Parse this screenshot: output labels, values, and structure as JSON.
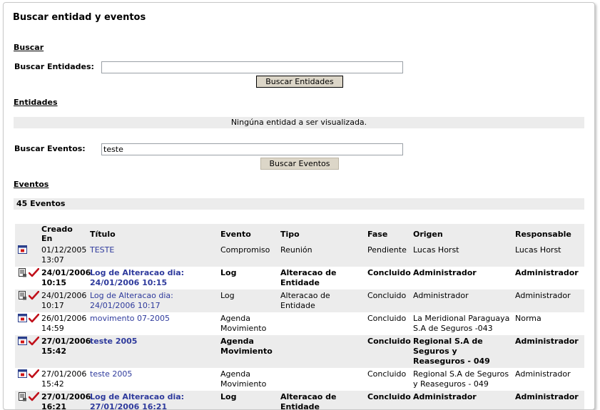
{
  "page_title": "Buscar entidad y eventos",
  "search_section": {
    "title": "Buscar",
    "entities_label": "Buscar Entidades:",
    "entities_value": "",
    "entities_button": "Buscar Entidades"
  },
  "entities_section": {
    "title": "Entidades",
    "empty_message": "Ningúna entidad a ser visualizada."
  },
  "events_search": {
    "label": "Buscar Eventos:",
    "value": "teste",
    "button": "Buscar Eventos"
  },
  "events_section": {
    "title": "Eventos",
    "count_label": "45 Eventos"
  },
  "table": {
    "headers": {
      "created": "Creado En",
      "title": "Título",
      "event": "Evento",
      "type": "Tipo",
      "phase": "Fase",
      "origin": "Origen",
      "responsible": "Responsable"
    },
    "rows": [
      {
        "icons": [
          "calendar-icon"
        ],
        "created": "01/12/2005 13:07",
        "title": "TESTE",
        "event": "Compromiso",
        "type": "Reunión",
        "phase": "Pendiente",
        "origin": "Lucas Horst",
        "responsible": "Lucas Horst",
        "bold": false
      },
      {
        "icons": [
          "log-icon",
          "check-icon"
        ],
        "created": "24/01/2006 10:15",
        "title": "Log de Alteracao dia: 24/01/2006 10:15",
        "event": "Log",
        "type": "Alteracao de Entidade",
        "phase": "Concluido",
        "origin": "Administrador",
        "responsible": "Administrador",
        "bold": true
      },
      {
        "icons": [
          "log-icon",
          "check-icon"
        ],
        "created": "24/01/2006 10:17",
        "title": "Log de Alteracao dia: 24/01/2006 10:17",
        "event": "Log",
        "type": "Alteracao de Entidade",
        "phase": "Concluido",
        "origin": "Administrador",
        "responsible": "Administrador",
        "bold": false
      },
      {
        "icons": [
          "calendar-icon",
          "check-icon"
        ],
        "created": "26/01/2006 14:59",
        "title": "movimento 07-2005",
        "event": "Agenda Movimiento",
        "type": "",
        "phase": "Concluido",
        "origin": "La Meridional Paraguaya S.A de Seguros -043",
        "responsible": "Norma",
        "bold": false
      },
      {
        "icons": [
          "calendar-icon",
          "check-icon"
        ],
        "created": "27/01/2006 15:42",
        "title": "teste 2005",
        "event": "Agenda Movimiento",
        "type": "",
        "phase": "Concluido",
        "origin": "Regional S.A de Seguros y Reaseguros - 049",
        "responsible": "Administrador",
        "bold": true
      },
      {
        "icons": [
          "calendar-icon",
          "check-icon"
        ],
        "created": "27/01/2006 15:42",
        "title": "teste 2005",
        "event": "Agenda Movimiento",
        "type": "",
        "phase": "Concluido",
        "origin": "Regional S.A de Seguros y Reaseguros - 049",
        "responsible": "Administrador",
        "bold": false
      },
      {
        "icons": [
          "log-icon",
          "check-icon"
        ],
        "created": "27/01/2006 16:21",
        "title": "Log de Alteracao dia: 27/01/2006 16:21",
        "event": "Log",
        "type": "Alteracao de Entidade",
        "phase": "Concluido",
        "origin": "Administrador",
        "responsible": "Administrador",
        "bold": true
      }
    ]
  },
  "colors": {
    "link": "#2e3a9c",
    "row_stripe": "#ececec",
    "button_bg": "#dcd6c8",
    "check": "#c0101a"
  }
}
